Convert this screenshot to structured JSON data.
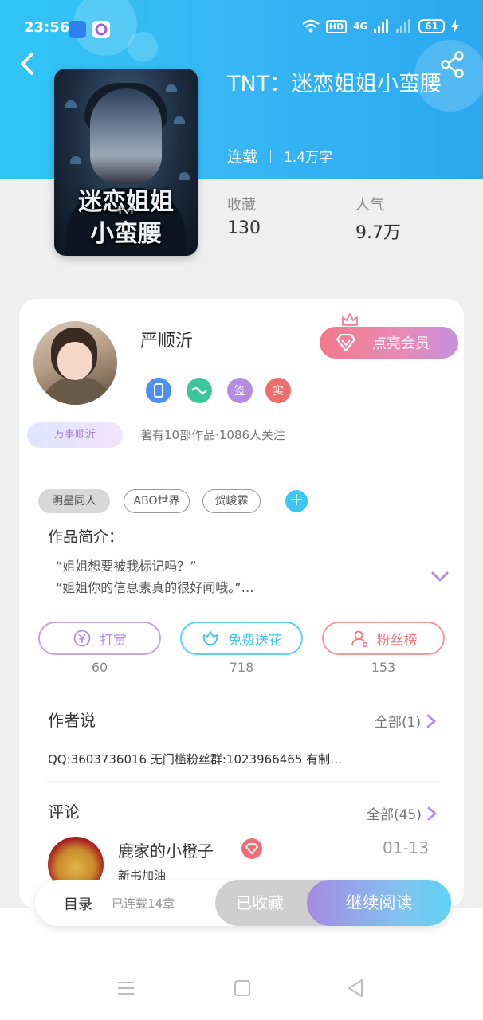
{
  "status_bar": {
    "time": "23:56",
    "network": "4G",
    "hd_label": "HD",
    "battery": "61"
  },
  "book": {
    "title": "TNT：迷恋姐姐小蛮腰",
    "cover_title_line1": "迷恋姐姐",
    "cover_title_line2": "小蛮腰",
    "cover_prefix": "TNT",
    "status": "连载",
    "words": "1.4万字",
    "collect_label": "收藏",
    "collect_value": "130",
    "popularity_label": "人气",
    "popularity_value": "9.7万"
  },
  "author": {
    "name": "严顺沂",
    "tag": "万事顺沂",
    "works": "著有10部作品·1086人关注",
    "vip_button": "点亮会员",
    "badges": [
      {
        "icon": "phone-icon",
        "color": "#4b8ff0",
        "text": ""
      },
      {
        "icon": "handshake-icon",
        "color": "#3cc79a",
        "text": ""
      },
      {
        "icon": "sign-icon",
        "color": "#b48de3",
        "text": "签"
      },
      {
        "icon": "verified-icon",
        "color": "#f06d6d",
        "text": "实"
      }
    ]
  },
  "tags": [
    "明星同人",
    "ABO世界",
    "贺峻霖"
  ],
  "intro": {
    "heading": "作品简介：",
    "line1": "“姐姐想要被我标记吗？”",
    "line2": "“姐姐你的信息素真的很好闻哦。”…"
  },
  "actions": {
    "reward": {
      "label": "打赏",
      "count": "60",
      "color": "#b48de3"
    },
    "flower": {
      "label": "免费送花",
      "count": "718",
      "color": "#3ec6e8"
    },
    "fans": {
      "label": "粉丝榜",
      "count": "153",
      "color": "#f07878"
    }
  },
  "author_say": {
    "heading": "作者说",
    "more": "全部(1)",
    "text": "QQ:3603736016 无门槛粉丝群:1023966465 有制…"
  },
  "comments": {
    "heading": "评论",
    "more": "全部(45)",
    "first": {
      "name": "鹿家的小橙子",
      "date": "01-13",
      "text": "新书加油"
    }
  },
  "bottom": {
    "toc": "目录",
    "chapters": "已连载14章",
    "collected": "已收藏",
    "continue": "继续阅读"
  }
}
